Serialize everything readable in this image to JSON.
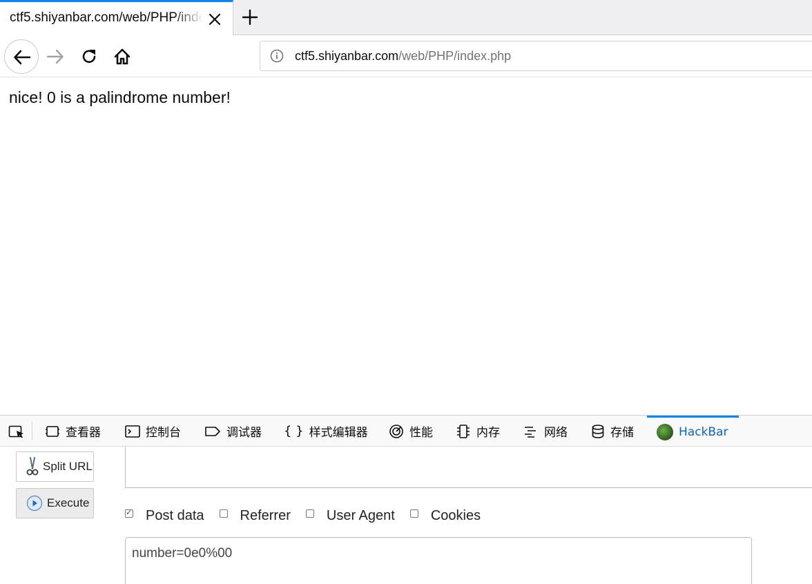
{
  "tab": {
    "title": "ctf5.shiyanbar.com/web/PHP/index.php"
  },
  "urlbar": {
    "host": "ctf5.shiyanbar.com",
    "path": "/web/PHP/index.php"
  },
  "page": {
    "message": "nice! 0 is a palindrome number!"
  },
  "devtools": {
    "tabs": [
      {
        "label": "查看器",
        "icon": "inspector-icon"
      },
      {
        "label": "控制台",
        "icon": "console-icon"
      },
      {
        "label": "调试器",
        "icon": "debugger-icon"
      },
      {
        "label": "样式编辑器",
        "icon": "style-editor-icon"
      },
      {
        "label": "性能",
        "icon": "performance-icon"
      },
      {
        "label": "内存",
        "icon": "memory-icon"
      },
      {
        "label": "网络",
        "icon": "network-icon"
      },
      {
        "label": "存储",
        "icon": "storage-icon"
      },
      {
        "label": "HackBar",
        "icon": "hackbar-icon",
        "active": true
      }
    ]
  },
  "hackbar": {
    "split_url_label": "Split URL",
    "execute_label": "Execute",
    "url_value": "",
    "options": [
      {
        "label": "Post data",
        "checked": true
      },
      {
        "label": "Referrer",
        "checked": false
      },
      {
        "label": "User Agent",
        "checked": false
      },
      {
        "label": "Cookies",
        "checked": false
      }
    ],
    "post_data_value": "number=0e0%00"
  },
  "colors": {
    "accent": "#0a84ff",
    "active_tab_text": "#0a64c8"
  }
}
